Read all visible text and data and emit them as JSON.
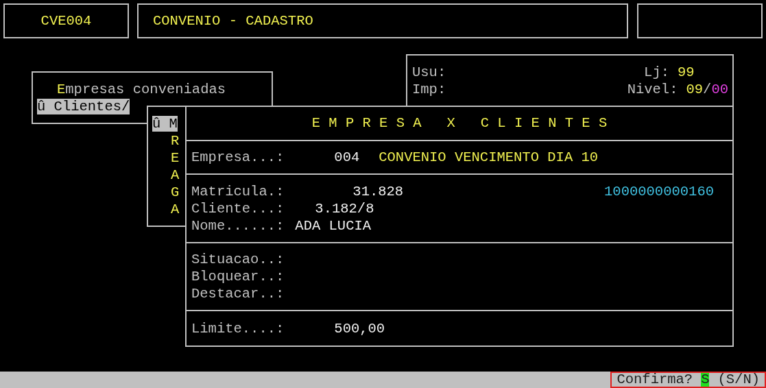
{
  "header": {
    "code": "CVE004",
    "title": "CONVENIO - CADASTRO"
  },
  "menu": {
    "items": [
      {
        "label": "Empresas conveniadas",
        "hotkey": true,
        "selected": false
      },
      {
        "label": "û Clientes/",
        "hotkey": false,
        "selected": true
      }
    ]
  },
  "submenu": {
    "items": [
      {
        "label": "û M",
        "selected": true
      },
      {
        "label": "R",
        "selected": false
      },
      {
        "label": "E",
        "selected": false
      },
      {
        "label": "A",
        "selected": false
      },
      {
        "label": "G",
        "selected": false
      },
      {
        "label": "A",
        "selected": false
      }
    ]
  },
  "info": {
    "usu_label": "Usu:",
    "imp_label": "Imp:",
    "lj_label": "Lj:",
    "lj_value": "99",
    "nivel_label": "Nivel:",
    "nivel_value": "09",
    "nivel_separator": "/",
    "nivel_max": "00"
  },
  "dialog": {
    "title": "E M P R E S A   X   C L I E N T E S",
    "sections": [
      {
        "rows": [
          {
            "label": "Empresa...:",
            "value": "004",
            "detail": "CONVENIO VENCIMENTO DIA 10"
          }
        ]
      },
      {
        "rows": [
          {
            "label": "Matricula.:",
            "value": "31.828",
            "detail": "1000000000160"
          },
          {
            "label": "Cliente...:",
            "value": "3.182/8"
          },
          {
            "label": "Nome......:",
            "value": "ADA LUCIA"
          }
        ]
      },
      {
        "rows": [
          {
            "label": "Situacao..:"
          },
          {
            "label": "Bloquear..:"
          },
          {
            "label": "Destacar..:"
          }
        ]
      },
      {
        "rows": [
          {
            "label": "Limite....:",
            "value": "500,00"
          }
        ]
      }
    ]
  },
  "status_bar": {
    "prompt": "Confirma?",
    "answer": "S",
    "options": "(S/N)"
  }
}
